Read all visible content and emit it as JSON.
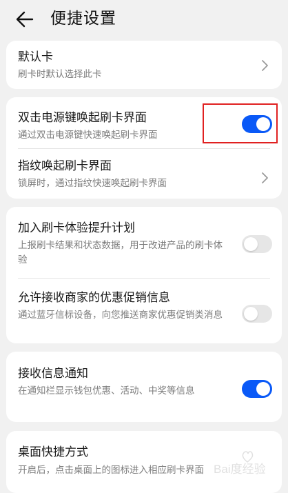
{
  "header": {
    "title": "便捷设置",
    "back_icon": "arrow-left-icon"
  },
  "default_card": {
    "title": "默认卡",
    "subtitle": "刷卡时默认选择此卡"
  },
  "double_click": {
    "title": "双击电源键唤起刷卡界面",
    "subtitle": "通过双击电源键快速唤起刷卡界面",
    "enabled": true
  },
  "fingerprint": {
    "title": "指纹唤起刷卡界面",
    "subtitle": "锁屏时，通过指纹快速唤起刷卡界面"
  },
  "experience_plan": {
    "title": "加入刷卡体验提升计划",
    "subtitle": "上报刷卡结果和状态数据，用于改进产品的刷卡体验",
    "enabled": false
  },
  "merchant_promo": {
    "title": "允许接收商家的优惠促销信息",
    "subtitle": "通过蓝牙信标设备，向您推送商家优惠促销类消息",
    "enabled": false
  },
  "notifications": {
    "title": "接收信息通知",
    "subtitle": "在通知栏显示钱包优惠、活动、中奖等信息",
    "enabled": true
  },
  "desktop_shortcut": {
    "title": "桌面快捷方式",
    "subtitle": "开启后，点击桌面上的图标进入相应刷卡界面"
  },
  "watermark": {
    "text": "Bai度经验"
  },
  "colors": {
    "accent": "#0a59f7",
    "highlight": "#e02020",
    "background": "#f1f1f1"
  }
}
